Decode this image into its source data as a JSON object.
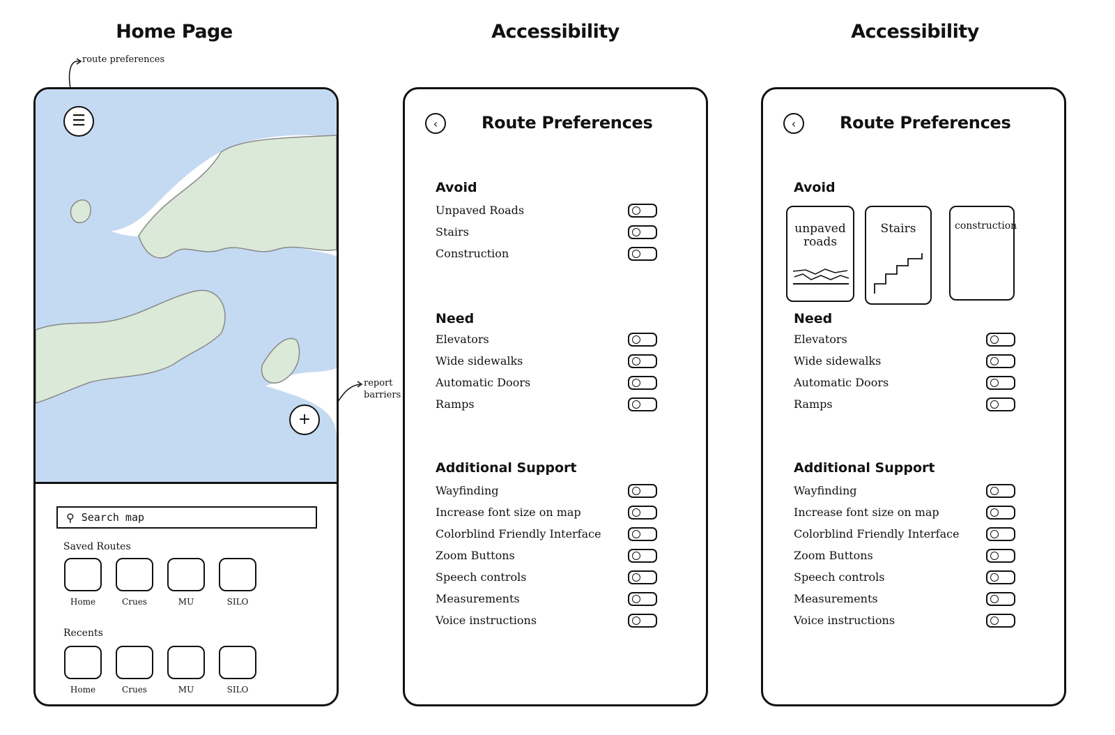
{
  "screens": {
    "home_title": "Home Page",
    "accessibility_title_1": "Accessibility",
    "accessibility_title_2": "Accessibility"
  },
  "annotations": {
    "route_preferences": "route preferences",
    "report_barriers": "report barriers"
  },
  "home": {
    "menu_icon": "menu-icon",
    "add_icon": "plus-icon",
    "search": {
      "placeholder": "Search map"
    },
    "saved_routes_label": "Saved Routes",
    "saved_routes": [
      "Home",
      "Crues",
      "MU",
      "SILO"
    ],
    "recents_label": "Recents",
    "recents": [
      "Home",
      "Crues",
      "MU",
      "SILO"
    ],
    "colors": {
      "water": "#c4daf2",
      "land": "#dbe9d8",
      "outline": "#111111"
    }
  },
  "preferences": {
    "title": "Route Preferences",
    "back_icon": "chevron-left-icon",
    "avoid_heading": "Avoid",
    "avoid_options": [
      "Unpaved Roads",
      "Stairs",
      "Construction"
    ],
    "avoid_cards": [
      "unpaved roads",
      "Stairs",
      "construction"
    ],
    "need_heading": "Need",
    "need_options": [
      "Elevators",
      "Wide sidewalks",
      "Automatic Doors",
      "Ramps"
    ],
    "support_heading": "Additional Support",
    "support_options": [
      "Wayfinding",
      "Increase font size on map",
      "Colorblind Friendly Interface",
      "Zoom Buttons",
      "Speech controls",
      "Measurements",
      "Voice instructions"
    ]
  }
}
